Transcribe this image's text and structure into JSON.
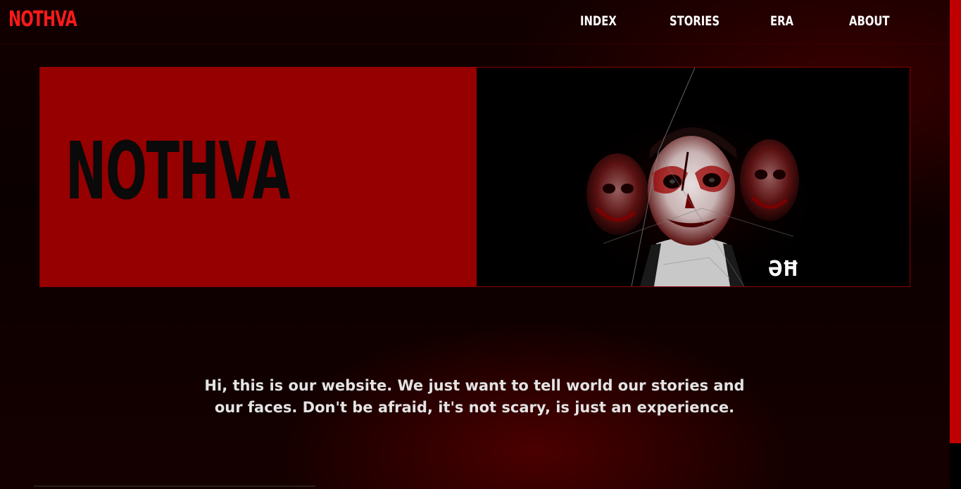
{
  "header": {
    "logo": "NOTHVA",
    "nav": [
      {
        "label": "INDEX"
      },
      {
        "label": "STORIES"
      },
      {
        "label": "ERA"
      },
      {
        "label": "ABOUT"
      }
    ]
  },
  "hero": {
    "title": "NOTHVA",
    "image_signature": "ƏĦ"
  },
  "intro": {
    "line1": "Hi, this is our website. We just want to tell world our stories and",
    "line2": "our faces. Don't be afraid, it's not scary, is just an experience."
  },
  "colors": {
    "accent": "#ff1a1a",
    "hero_panel": "#960000",
    "background": "#0b0000",
    "scrollbar": "#c00000"
  }
}
